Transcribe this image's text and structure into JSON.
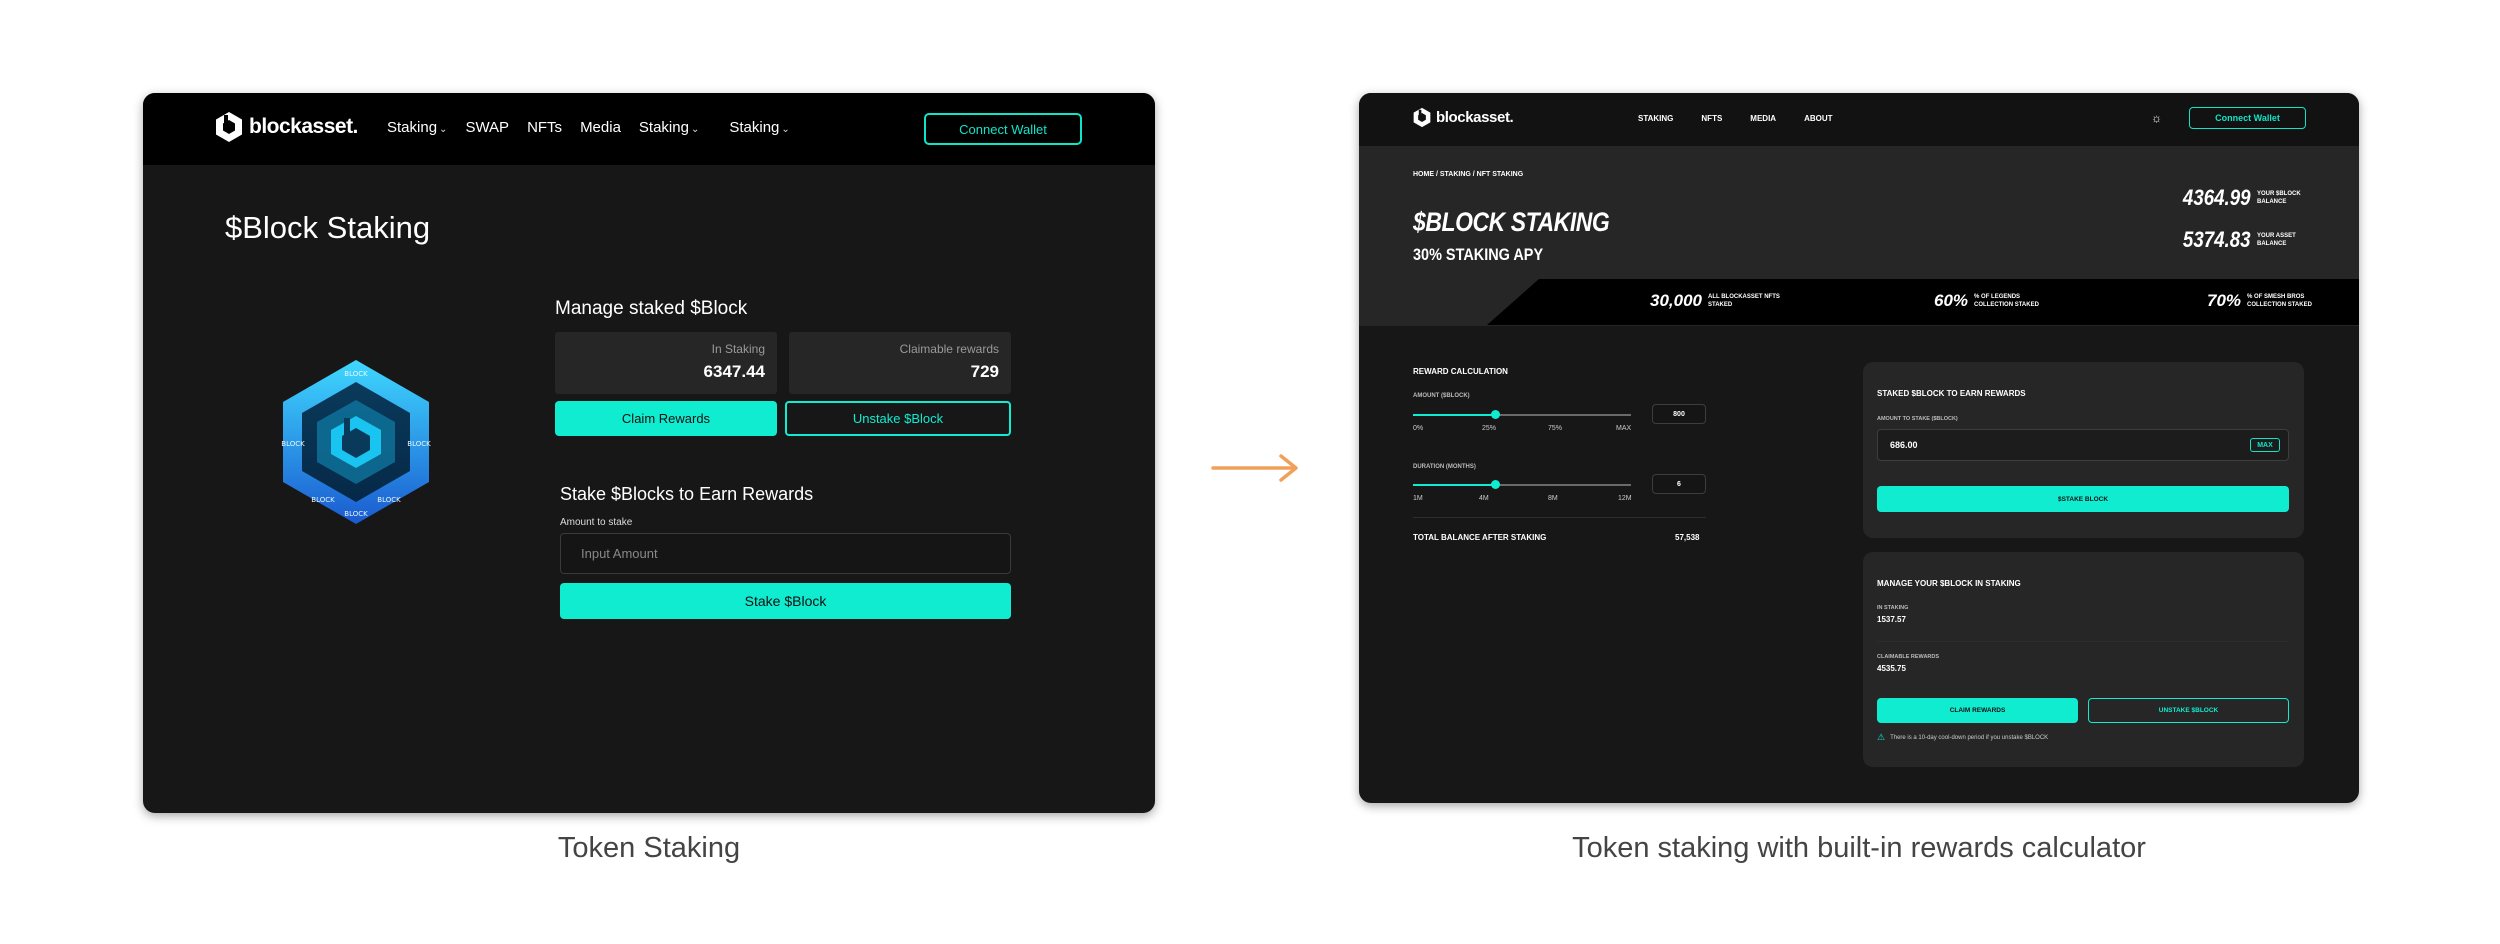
{
  "colors": {
    "accent": "#10ecd0",
    "frame_bg": "#171717",
    "arrow": "#f0a05a"
  },
  "left": {
    "logo_text": "blockasset.",
    "nav": [
      "Staking",
      "SWAP",
      "NFTs",
      "Media",
      "Staking",
      "Staking"
    ],
    "connect_label": "Connect Wallet",
    "title": "$Block Staking",
    "manage_title": "Manage staked $Block",
    "in_staking_label": "In Staking",
    "in_staking_value": "6347.44",
    "claimable_label": "Claimable rewards",
    "claimable_value": "729",
    "claim_label": "Claim Rewards",
    "unstake_label": "Unstake $Block",
    "stake_title": "Stake $Blocks to Earn Rewards",
    "amount_label": "Amount to stake",
    "input_placeholder": "Input Amount",
    "stake_button": "Stake $Block",
    "badge_ring_text": [
      "BLOCK",
      "BLOCK",
      "BLOCK",
      "BLOCK",
      "BLOCK",
      "BLOCK"
    ]
  },
  "captions": {
    "left": "Token Staking",
    "right": "Token staking with built-in rewards calculator"
  },
  "right": {
    "logo_text": "blockasset.",
    "nav": [
      "STAKING",
      "NFTS",
      "MEDIA",
      "ABOUT"
    ],
    "connect_label": "Connect Wallet",
    "breadcrumb": "HOME  / STAKING / NFT STAKING",
    "title": "$BLOCK STAKING",
    "apy": "30% STAKING APY",
    "balance_block_value": "4364.99",
    "balance_block_label": "YOUR $BLOCK BALANCE",
    "balance_asset_value": "5374.83",
    "balance_asset_label": "YOUR ASSET BALANCE",
    "stats": [
      {
        "value": "30,000",
        "label": "ALL BLOCKASSET NFTS STAKED"
      },
      {
        "value": "60%",
        "label": "% OF LEGENDS COLLECTION STAKED"
      },
      {
        "value": "70%",
        "label": "% OF SMESH BROS COLLECTION STAKED"
      }
    ],
    "calc": {
      "title": "REWARD CALCULATION",
      "amount_label": "AMOUNT ($BLOCK)",
      "amount_ticks": [
        "0%",
        "25%",
        "75%",
        "MAX"
      ],
      "amount_value": "800",
      "amount_fraction": 0.38,
      "duration_label": "DURATION (MONTHS)",
      "duration_ticks": [
        "1M",
        "4M",
        "8M",
        "12M"
      ],
      "duration_value": "6",
      "duration_fraction": 0.38,
      "total_label": "TOTAL BALANCE AFTER STAKING",
      "total_value": "57,538"
    },
    "stake_card": {
      "title": "STAKED $BLOCK TO EARN REWARDS",
      "amount_label": "AMOUNT TO STAKE ($BLOCK)",
      "input_value": "686.00",
      "max_label": "MAX",
      "button": "$STAKE BLOCK"
    },
    "manage_card": {
      "title": "MANAGE YOUR $BLOCK IN STAKING",
      "in_staking_label": "IN STAKING",
      "in_staking_value": "1537.57",
      "claimable_label": "CLAIMABLE REWARDS",
      "claimable_value": "4535.75",
      "claim_button": "CLAIM REWARDS",
      "unstake_button": "UNSTAKE $BLOCK",
      "warning": "There is a 10-day cool-down period if you unstake $BLOCK"
    }
  }
}
